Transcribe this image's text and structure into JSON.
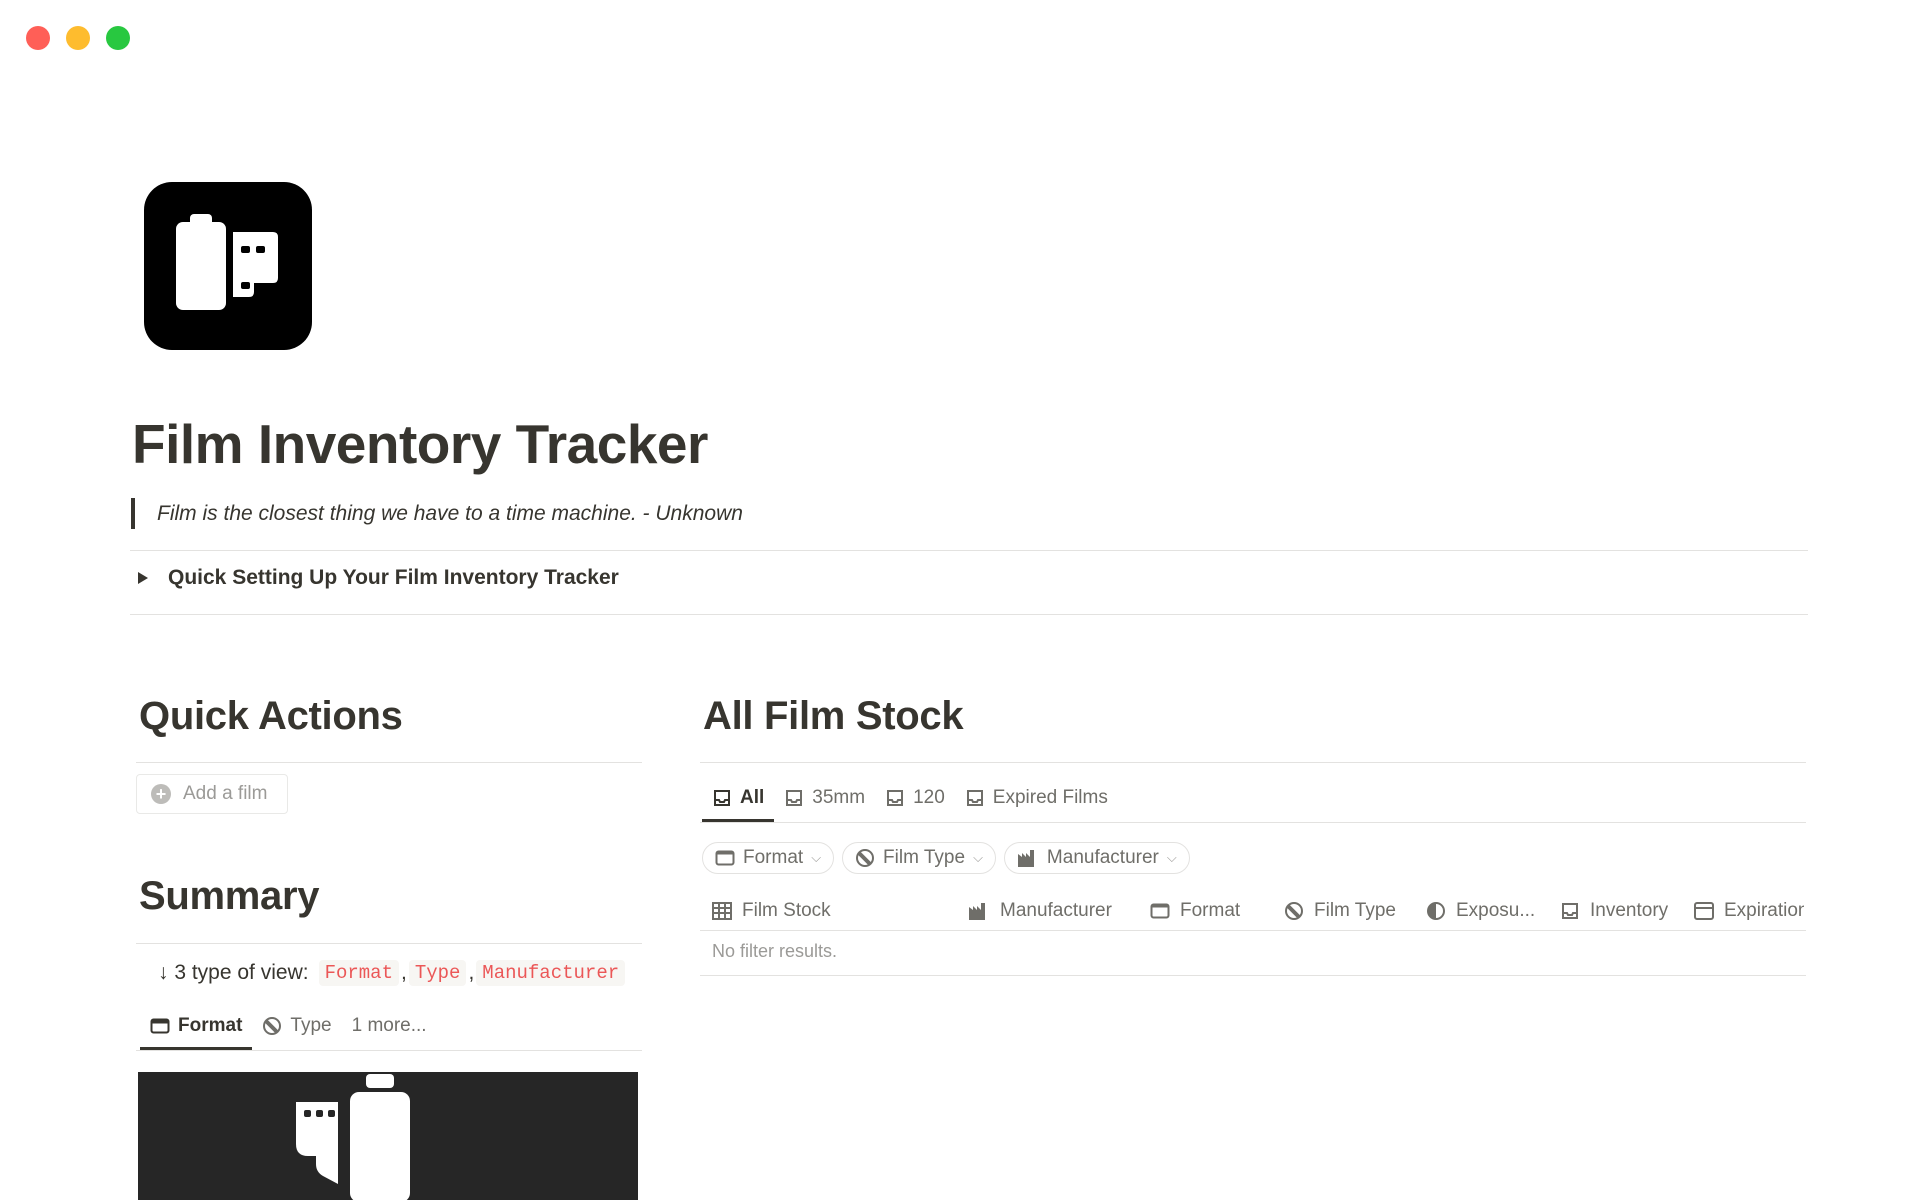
{
  "window": {
    "controls": [
      "close",
      "minimize",
      "zoom"
    ],
    "colors": {
      "close": "#ff5f57",
      "minimize": "#febc2e",
      "zoom": "#28c840"
    }
  },
  "page": {
    "icon": "film-canister-icon",
    "title": "Film Inventory Tracker",
    "quote": "Film is the closest thing we have to a time machine. - Unknown",
    "toggle_label": "Quick Setting Up Your Film Inventory Tracker"
  },
  "quick_actions": {
    "heading": "Quick Actions",
    "add_button_label": "Add a film"
  },
  "summary": {
    "heading": "Summary",
    "views_prefix": "↓ 3 type of view:",
    "view_codes": [
      "Format",
      "Type",
      "Manufacturer"
    ],
    "separators": [
      ",",
      ","
    ],
    "tabs": [
      {
        "label": "Format",
        "icon": "format-icon",
        "active": true
      },
      {
        "label": "Type",
        "icon": "type-icon",
        "active": false
      },
      {
        "label": "1 more...",
        "icon": "",
        "active": false
      }
    ],
    "gallery_icon": "film-roll-icon"
  },
  "film_stock": {
    "heading": "All Film Stock",
    "tabs": [
      {
        "label": "All",
        "icon": "inbox-icon",
        "active": true
      },
      {
        "label": "35mm",
        "icon": "inbox-icon",
        "active": false
      },
      {
        "label": "120",
        "icon": "inbox-icon",
        "active": false
      },
      {
        "label": "Expired Films",
        "icon": "inbox-icon",
        "active": false
      }
    ],
    "filters": [
      {
        "label": "Format",
        "icon": "format-icon"
      },
      {
        "label": "Film Type",
        "icon": "type-icon"
      },
      {
        "label": "Manufacturer",
        "icon": "factory-icon"
      }
    ],
    "columns": [
      {
        "label": "Film Stock",
        "icon": "table-icon"
      },
      {
        "label": "Manufacturer",
        "icon": "factory-icon"
      },
      {
        "label": "Format",
        "icon": "format-icon"
      },
      {
        "label": "Film Type",
        "icon": "type-icon"
      },
      {
        "label": "Exposu...",
        "icon": "exposure-icon"
      },
      {
        "label": "Inventory",
        "icon": "inbox-icon"
      },
      {
        "label": "Expiration",
        "icon": "calendar-icon"
      }
    ],
    "empty_text": "No filter results."
  }
}
